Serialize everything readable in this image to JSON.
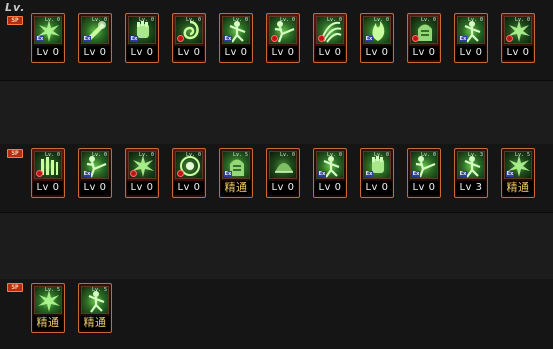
{
  "header": {
    "title": "Lv."
  },
  "row_tag": "SP",
  "rows": [
    {
      "name": "row-1",
      "skills": [
        {
          "level_text": "Lv 0",
          "icon_lv": "Lv. 0",
          "badge": "ex",
          "variant": "green",
          "glyph": "burst"
        },
        {
          "level_text": "Lv 0",
          "icon_lv": "Lv. 0",
          "badge": "ex",
          "variant": "green",
          "glyph": "strike"
        },
        {
          "level_text": "Lv 0",
          "icon_lv": "Lv. 0",
          "badge": "ex",
          "variant": "dark",
          "glyph": "fist"
        },
        {
          "level_text": "Lv 0",
          "icon_lv": "Lv. 0",
          "badge": "red",
          "variant": "dark",
          "glyph": "swirl"
        },
        {
          "level_text": "Lv 0",
          "icon_lv": "Lv. 0",
          "badge": "ex",
          "variant": "green",
          "glyph": "fighter"
        },
        {
          "level_text": "Lv 0",
          "icon_lv": "Lv. 0",
          "badge": "red",
          "variant": "green",
          "glyph": "kick"
        },
        {
          "level_text": "Lv 0",
          "icon_lv": "Lv. 0",
          "badge": "red",
          "variant": "green",
          "glyph": "claw"
        },
        {
          "level_text": "Lv 0",
          "icon_lv": "Lv. 0",
          "badge": "ex",
          "variant": "green",
          "glyph": "flame"
        },
        {
          "level_text": "Lv 0",
          "icon_lv": "Lv. 0",
          "badge": "red",
          "variant": "dark",
          "glyph": "muscle"
        },
        {
          "level_text": "Lv 0",
          "icon_lv": "Lv. 0",
          "badge": "ex",
          "variant": "green",
          "glyph": "fighter"
        },
        {
          "level_text": "Lv 0",
          "icon_lv": "Lv. 0",
          "badge": "red",
          "variant": "dark",
          "glyph": "burst"
        }
      ]
    },
    {
      "name": "row-2",
      "skills": [
        {
          "level_text": "Lv 0",
          "icon_lv": "Lv. 0",
          "badge": "red",
          "variant": "dark",
          "glyph": "bars"
        },
        {
          "level_text": "Lv 0",
          "icon_lv": "Lv. 0",
          "badge": "ex",
          "variant": "green",
          "glyph": "kick"
        },
        {
          "level_text": "Lv 0",
          "icon_lv": "Lv. 0",
          "badge": "red",
          "variant": "dark",
          "glyph": "burst"
        },
        {
          "level_text": "Lv 0",
          "icon_lv": "Lv. 0",
          "badge": "red",
          "variant": "dark",
          "glyph": "orb"
        },
        {
          "level_text": "精通",
          "icon_lv": "Lv. 5",
          "badge": "ex",
          "variant": "green",
          "glyph": "muscle",
          "mastery": true
        },
        {
          "level_text": "Lv 0",
          "icon_lv": "Lv. 0",
          "badge": "none",
          "variant": "dark",
          "glyph": "dome"
        },
        {
          "level_text": "Lv 0",
          "icon_lv": "Lv. 0",
          "badge": "ex",
          "variant": "green",
          "glyph": "fighter"
        },
        {
          "level_text": "Lv 0",
          "icon_lv": "Lv. 0",
          "badge": "ex",
          "variant": "green",
          "glyph": "fist"
        },
        {
          "level_text": "Lv 0",
          "icon_lv": "Lv. 0",
          "badge": "ex",
          "variant": "green",
          "glyph": "kick"
        },
        {
          "level_text": "Lv 3",
          "icon_lv": "Lv. 3",
          "badge": "ex",
          "variant": "green",
          "glyph": "fighter"
        },
        {
          "level_text": "精通",
          "icon_lv": "Lv. 5",
          "badge": "ex",
          "variant": "dark",
          "glyph": "burst",
          "mastery": true
        }
      ]
    },
    {
      "name": "row-3",
      "skills": [
        {
          "level_text": "精通",
          "icon_lv": "Lv. 5",
          "badge": "none",
          "variant": "green",
          "glyph": "burst",
          "mastery": true
        },
        {
          "level_text": "精通",
          "icon_lv": "Lv. 5",
          "badge": "none",
          "variant": "green",
          "glyph": "fighter",
          "mastery": true
        }
      ]
    }
  ],
  "colors": {
    "frame_border": "#c96a35",
    "mastery_text": "#f0c96a",
    "level_text": "#f2f2f2",
    "ex_badge": "#2b3d9a",
    "red_badge": "#c01414"
  }
}
